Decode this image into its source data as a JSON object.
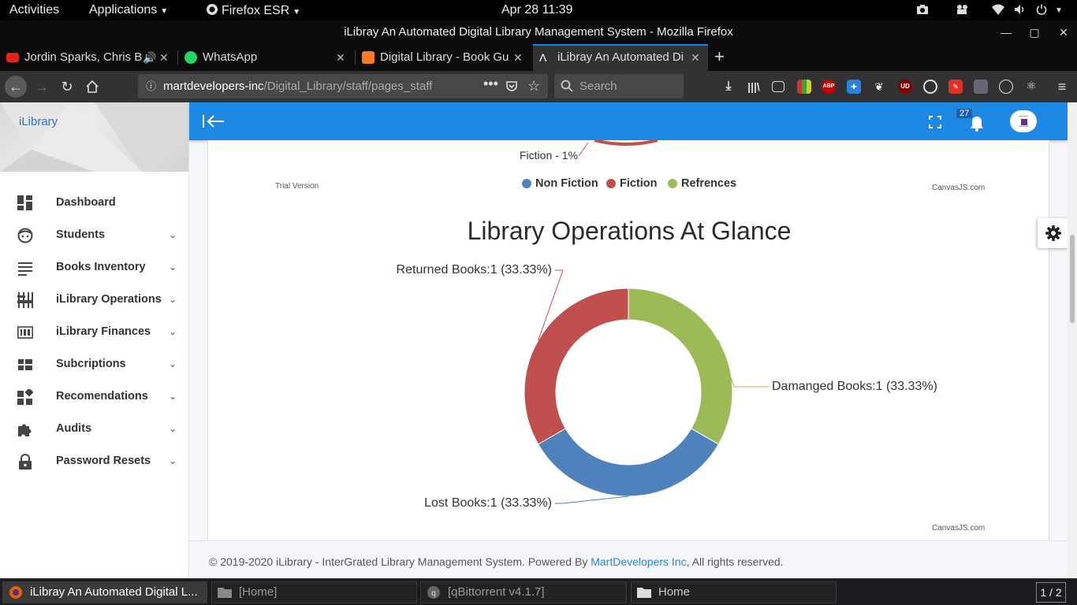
{
  "topbar": {
    "activities": "Activities",
    "applications": "Applications",
    "browser": "Firefox ESR",
    "clock": "Apr 28  11:39"
  },
  "window": {
    "title": "iLibray An Automated Digital Library Management System - Mozilla Firefox"
  },
  "tabs": [
    {
      "title": "Jordin Sparks, Chris B",
      "color": "#e62117"
    },
    {
      "title": "WhatsApp",
      "color": "#25d366"
    },
    {
      "title": "Digital Library - Book Gu",
      "color": "#fb7a24"
    },
    {
      "title": "iLibray An Automated Di",
      "color": "#ffffff"
    }
  ],
  "navbar": {
    "url_host": "martdevelopers-inc",
    "url_path": "/Digital_Library/staff/pages_staff",
    "search_placeholder": "Search"
  },
  "sidebar": {
    "brand": "iLibrary",
    "items": [
      {
        "label": "Dashboard",
        "icon": "dashboard-icon",
        "has_submenu": false
      },
      {
        "label": "Students",
        "icon": "face-icon",
        "has_submenu": true
      },
      {
        "label": "Books Inventory",
        "icon": "list-icon",
        "has_submenu": true
      },
      {
        "label": "iLibrary Operations",
        "icon": "equalizer-icon",
        "has_submenu": true
      },
      {
        "label": "iLibrary Finances",
        "icon": "counter-icon",
        "has_submenu": true
      },
      {
        "label": "Subcriptions",
        "icon": "grid-icon",
        "has_submenu": true
      },
      {
        "label": "Recomendations",
        "icon": "widgets-icon",
        "has_submenu": true
      },
      {
        "label": "Audits",
        "icon": "puzzle-icon",
        "has_submenu": true
      },
      {
        "label": "Password Resets",
        "icon": "lock-icon",
        "has_submenu": true
      }
    ]
  },
  "header": {
    "notification_count": "27"
  },
  "top_chart": {
    "slice_label": "Fiction - 1%",
    "trial_text": "Trial Version",
    "credit": "CanvasJS.com",
    "legend": [
      {
        "name": "Non Fiction",
        "color": "#4f81bc"
      },
      {
        "name": "Fiction",
        "color": "#c0504e"
      },
      {
        "name": "Refrences",
        "color": "#9bbb58"
      }
    ]
  },
  "chart_data": {
    "type": "pie",
    "title": "Library Operations At Glance",
    "donut": true,
    "slices": [
      {
        "name": "Returned Books",
        "value": 1,
        "percent": 33.33,
        "color": "#c0504e",
        "label": "Returned Books:1 (33.33%)"
      },
      {
        "name": "Damanged Books",
        "value": 1,
        "percent": 33.33,
        "color": "#9bbb58",
        "label": "Damanged Books:1 (33.33%)"
      },
      {
        "name": "Lost Books",
        "value": 1,
        "percent": 33.33,
        "color": "#4f81bc",
        "label": "Lost Books:1 (33.33%)"
      }
    ],
    "credit": "CanvasJS.com"
  },
  "footer": {
    "prefix": "© 2019-2020 iLibrary - InterGrated Library Management System. Powered By ",
    "link": "MartDevelopers Inc",
    "suffix": ", All rights reserved."
  },
  "taskbar": {
    "tasks": [
      {
        "title": "iLibray An Automated Digital L...",
        "active": true
      },
      {
        "title": "[Home]",
        "active": false
      },
      {
        "title": "[qBittorrent v4.1.7]",
        "active": false
      },
      {
        "title": "Home",
        "active": false
      }
    ],
    "pager": "1 / 2"
  }
}
